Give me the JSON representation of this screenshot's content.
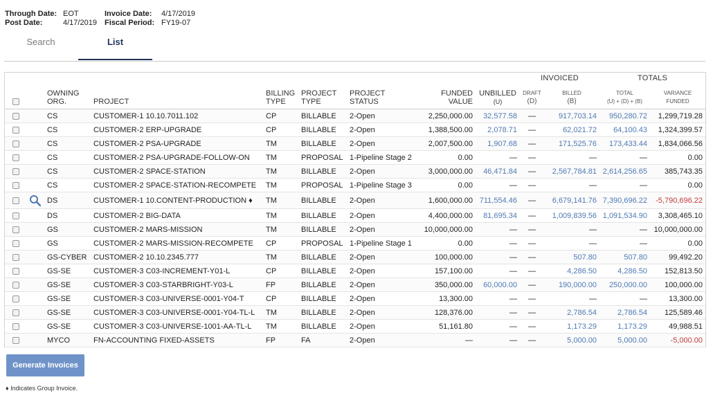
{
  "header": {
    "through_date_label": "Through Date:",
    "through_date_value": "EOT",
    "invoice_date_label": "Invoice Date:",
    "invoice_date_value": "4/17/2019",
    "post_date_label": "Post Date:",
    "post_date_value": "4/17/2019",
    "fiscal_period_label": "Fiscal Period:",
    "fiscal_period_value": "FY19-07"
  },
  "tabs": {
    "search": "Search",
    "list": "List",
    "active": "List"
  },
  "table": {
    "group_headers": {
      "invoiced": "INVOICED",
      "totals": "TOTALS"
    },
    "columns": {
      "owning_org": [
        "OWNING",
        "ORG."
      ],
      "project": "PROJECT",
      "billing_type": [
        "BILLING",
        "TYPE"
      ],
      "project_type": [
        "PROJECT",
        "TYPE"
      ],
      "project_status": [
        "PROJECT",
        "STATUS"
      ],
      "funded_value": [
        "FUNDED",
        "VALUE"
      ],
      "unbilled": [
        "UNBILLED",
        "(U)"
      ],
      "draft": [
        "DRAFT",
        "(D)"
      ],
      "billed": [
        "BILLED",
        "(B)"
      ],
      "total": [
        "TOTAL",
        "(U) + (D) + (B)"
      ],
      "variance": [
        "VARIANCE",
        "FUNDED"
      ]
    },
    "rows": [
      {
        "org": "CS",
        "project": "CUSTOMER-1 10.10.7011.102",
        "billing": "CP",
        "ptype": "BILLABLE",
        "status": "2-Open",
        "funded": "2,250,000.00",
        "unbilled": "32,577.58",
        "draft": "—",
        "billed": "917,703.14",
        "total": "950,280.72",
        "variance": "1,299,719.28"
      },
      {
        "org": "CS",
        "project": "CUSTOMER-2 ERP-UPGRADE",
        "billing": "CP",
        "ptype": "BILLABLE",
        "status": "2-Open",
        "funded": "1,388,500.00",
        "unbilled": "2,078.71",
        "draft": "—",
        "billed": "62,021.72",
        "total": "64,100.43",
        "variance": "1,324,399.57"
      },
      {
        "org": "CS",
        "project": "CUSTOMER-2 PSA-UPGRADE",
        "billing": "TM",
        "ptype": "BILLABLE",
        "status": "2-Open",
        "funded": "2,007,500.00",
        "unbilled": "1,907.68",
        "draft": "—",
        "billed": "171,525.76",
        "total": "173,433.44",
        "variance": "1,834,066.56"
      },
      {
        "org": "CS",
        "project": "CUSTOMER-2 PSA-UPGRADE-FOLLOW-ON",
        "billing": "TM",
        "ptype": "PROPOSAL",
        "status": "1-Pipeline Stage 2",
        "funded": "0.00",
        "unbilled": "—",
        "draft": "—",
        "billed": "—",
        "total": "—",
        "variance": "0.00"
      },
      {
        "org": "CS",
        "project": "CUSTOMER-2 SPACE-STATION",
        "billing": "TM",
        "ptype": "BILLABLE",
        "status": "2-Open",
        "funded": "3,000,000.00",
        "unbilled": "46,471.84",
        "draft": "—",
        "billed": "2,567,784.81",
        "total": "2,614,256.65",
        "variance": "385,743.35"
      },
      {
        "org": "CS",
        "project": "CUSTOMER-2 SPACE-STATION-RECOMPETE",
        "billing": "TM",
        "ptype": "PROPOSAL",
        "status": "1-Pipeline Stage 3",
        "funded": "0.00",
        "unbilled": "—",
        "draft": "—",
        "billed": "—",
        "total": "—",
        "variance": "0.00"
      },
      {
        "org": "DS",
        "project": "CUSTOMER-1 10.CONTENT-PRODUCTION ♦",
        "billing": "TM",
        "ptype": "BILLABLE",
        "status": "2-Open",
        "funded": "1,600,000.00",
        "unbilled": "711,554.46",
        "draft": "—",
        "billed": "6,679,141.76",
        "total": "7,390,696.22",
        "variance": "-5,790,696.22",
        "magnifier": true
      },
      {
        "org": "DS",
        "project": "CUSTOMER-2 BIG-DATA",
        "billing": "TM",
        "ptype": "BILLABLE",
        "status": "2-Open",
        "funded": "4,400,000.00",
        "unbilled": "81,695.34",
        "draft": "—",
        "billed": "1,009,839.56",
        "total": "1,091,534.90",
        "variance": "3,308,465.10"
      },
      {
        "org": "GS",
        "project": "CUSTOMER-2 MARS-MISSION",
        "billing": "TM",
        "ptype": "BILLABLE",
        "status": "2-Open",
        "funded": "10,000,000.00",
        "unbilled": "—",
        "draft": "—",
        "billed": "—",
        "total": "—",
        "variance": "10,000,000.00"
      },
      {
        "org": "GS",
        "project": "CUSTOMER-2 MARS-MISSION-RECOMPETE",
        "billing": "CP",
        "ptype": "PROPOSAL",
        "status": "1-Pipeline Stage 1",
        "funded": "0.00",
        "unbilled": "—",
        "draft": "—",
        "billed": "—",
        "total": "—",
        "variance": "0.00"
      },
      {
        "org": "GS-CYBER",
        "project": "CUSTOMER-2 10.10.2345.777",
        "billing": "TM",
        "ptype": "BILLABLE",
        "status": "2-Open",
        "funded": "100,000.00",
        "unbilled": "—",
        "draft": "—",
        "billed": "507.80",
        "total": "507.80",
        "variance": "99,492.20"
      },
      {
        "org": "GS-SE",
        "project": "CUSTOMER-3 C03-INCREMENT-Y01-L",
        "billing": "CP",
        "ptype": "BILLABLE",
        "status": "2-Open",
        "funded": "157,100.00",
        "unbilled": "—",
        "draft": "—",
        "billed": "4,286.50",
        "total": "4,286.50",
        "variance": "152,813.50"
      },
      {
        "org": "GS-SE",
        "project": "CUSTOMER-3 C03-STARBRIGHT-Y03-L",
        "billing": "FP",
        "ptype": "BILLABLE",
        "status": "2-Open",
        "funded": "350,000.00",
        "unbilled": "60,000.00",
        "draft": "—",
        "billed": "190,000.00",
        "total": "250,000.00",
        "variance": "100,000.00"
      },
      {
        "org": "GS-SE",
        "project": "CUSTOMER-3 C03-UNIVERSE-0001-Y04-T",
        "billing": "CP",
        "ptype": "BILLABLE",
        "status": "2-Open",
        "funded": "13,300.00",
        "unbilled": "—",
        "draft": "—",
        "billed": "—",
        "total": "—",
        "variance": "13,300.00"
      },
      {
        "org": "GS-SE",
        "project": "CUSTOMER-3 C03-UNIVERSE-0001-Y04-TL-L",
        "billing": "TM",
        "ptype": "BILLABLE",
        "status": "2-Open",
        "funded": "128,376.00",
        "unbilled": "—",
        "draft": "—",
        "billed": "2,786.54",
        "total": "2,786.54",
        "variance": "125,589.46"
      },
      {
        "org": "GS-SE",
        "project": "CUSTOMER-3 C03-UNIVERSE-1001-AA-TL-L",
        "billing": "TM",
        "ptype": "BILLABLE",
        "status": "2-Open",
        "funded": "51,161.80",
        "unbilled": "—",
        "draft": "—",
        "billed": "1,173.29",
        "total": "1,173.29",
        "variance": "49,988.51"
      },
      {
        "org": "MYCO",
        "project": "FN-ACCOUNTING FIXED-ASSETS",
        "billing": "FP",
        "ptype": "FA",
        "status": "2-Open",
        "funded": "—",
        "unbilled": "—",
        "draft": "—",
        "billed": "5,000.00",
        "total": "5,000.00",
        "variance": "-5,000.00"
      }
    ]
  },
  "actions": {
    "generate_label": "Generate Invoices"
  },
  "footnote": "♦ Indicates Group Invoice.",
  "colors": {
    "link": "#4f79b4",
    "negative": "#c23c3c",
    "button": "#6f93c9",
    "tab_active": "#1f3358"
  }
}
